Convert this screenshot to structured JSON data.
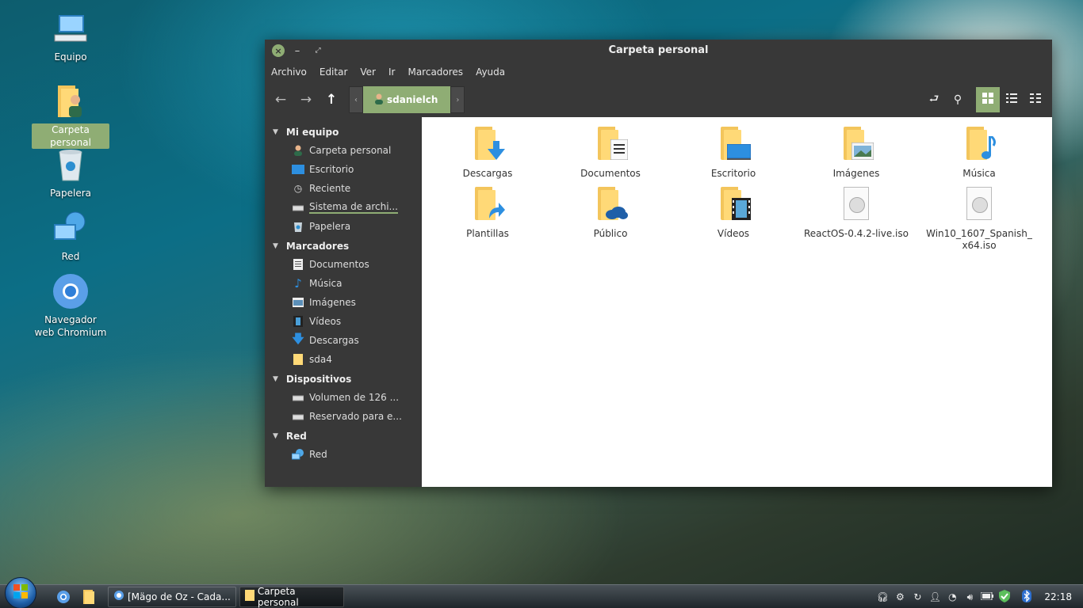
{
  "desktop": {
    "icons": [
      {
        "label": "Equipo"
      },
      {
        "label": "Carpeta personal"
      },
      {
        "label": "Papelera"
      },
      {
        "label": "Red"
      },
      {
        "label": "Navegador web Chromium"
      }
    ]
  },
  "window": {
    "title": "Carpeta personal",
    "menu": [
      "Archivo",
      "Editar",
      "Ver",
      "Ir",
      "Marcadores",
      "Ayuda"
    ],
    "path_crumb": "sdanielch"
  },
  "sidebar": {
    "sections": [
      {
        "title": "Mi equipo",
        "items": [
          "Carpeta personal",
          "Escritorio",
          "Reciente",
          "Sistema de archi...",
          "Papelera"
        ]
      },
      {
        "title": "Marcadores",
        "items": [
          "Documentos",
          "Música",
          "Imágenes",
          "Vídeos",
          "Descargas",
          "sda4"
        ]
      },
      {
        "title": "Dispositivos",
        "items": [
          "Volumen de 126 ...",
          "Reservado para e..."
        ]
      },
      {
        "title": "Red",
        "items": [
          "Red"
        ]
      }
    ]
  },
  "files": [
    {
      "name": "Descargas",
      "kind": "folder",
      "overlay": "download-arrow-icon"
    },
    {
      "name": "Documentos",
      "kind": "folder",
      "overlay": "document-icon"
    },
    {
      "name": "Escritorio",
      "kind": "folder",
      "overlay": "monitor-icon"
    },
    {
      "name": "Imágenes",
      "kind": "folder",
      "overlay": "picture-icon"
    },
    {
      "name": "Música",
      "kind": "folder",
      "overlay": "music-note-icon"
    },
    {
      "name": "Plantillas",
      "kind": "folder",
      "overlay": "shortcut-arrow-icon"
    },
    {
      "name": "Público",
      "kind": "folder",
      "overlay": "cloud-icon"
    },
    {
      "name": "Vídeos",
      "kind": "folder",
      "overlay": "film-icon"
    },
    {
      "name": "ReactOS-0.4.2-live.iso",
      "kind": "iso"
    },
    {
      "name": "Win10_1607_Spanish_x64.iso",
      "kind": "iso"
    }
  ],
  "taskbar": {
    "tasks": [
      {
        "label": "[Mägo de Oz - Cada..."
      },
      {
        "label": "Carpeta personal"
      }
    ],
    "clock": "22:18"
  },
  "colors": {
    "accent": "#8fad74",
    "window_bg": "#383838",
    "folder": "#ffd977"
  }
}
